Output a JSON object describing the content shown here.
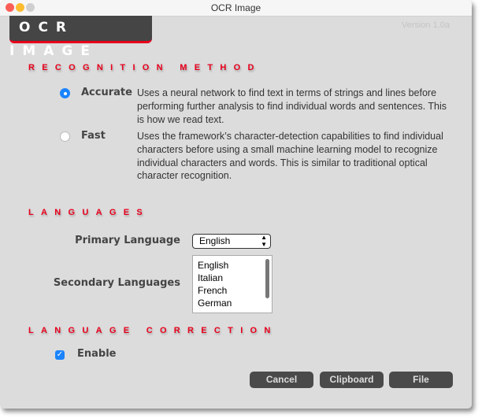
{
  "window": {
    "title": "OCR Image"
  },
  "header": {
    "logo": "OCR IMAGE",
    "version": "Version 1.0a"
  },
  "recognition": {
    "heading": "RECOGNITION METHOD",
    "options": [
      {
        "label": "Accurate",
        "selected": true,
        "description": "Uses a neural network to find text in terms of strings and lines before performing further analysis to find individual words and sentences. This is how we read text."
      },
      {
        "label": "Fast",
        "selected": false,
        "description": "Uses the framework’s character-detection capabilities to find individual characters before using a small machine learning model to recognize individual characters and words. This is similar to traditional optical character recognition."
      }
    ]
  },
  "languages": {
    "heading": "LANGUAGES",
    "primary_label": "Primary Language",
    "primary_value": "English",
    "secondary_label": "Secondary Languages",
    "secondary_items": [
      "English",
      "Italian",
      "French",
      "German"
    ]
  },
  "correction": {
    "heading": "LANGUAGE CORRECTION",
    "enable_label": "Enable",
    "enabled": true
  },
  "buttons": {
    "cancel": "Cancel",
    "clipboard": "Clipboard",
    "file": "File"
  },
  "colors": {
    "accent": "#e8001c",
    "background": "#dcdcdc",
    "button": "#4a4a4a",
    "control_blue": "#1a84ff"
  }
}
